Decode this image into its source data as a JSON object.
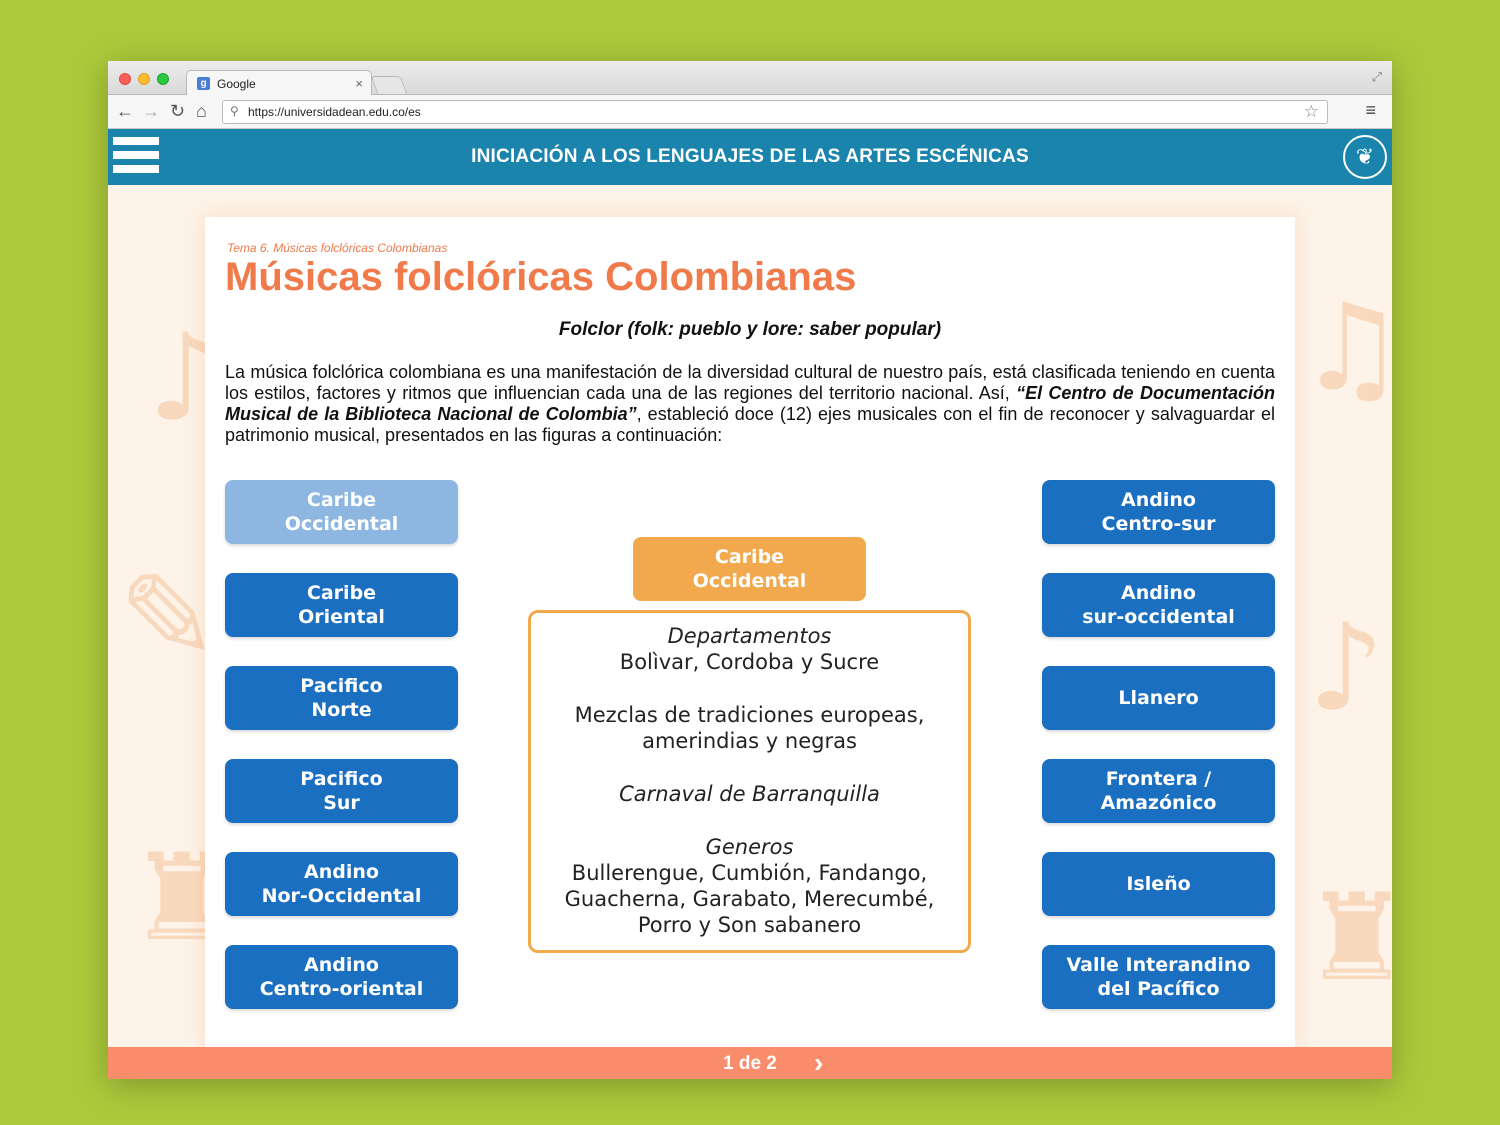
{
  "browser": {
    "tab_title": "Google",
    "tab_favicon": "g",
    "url": "https://universidadean.edu.co/es",
    "icons": [
      "back-icon",
      "forward-icon",
      "reload-icon",
      "home-icon",
      "search-icon",
      "star-icon",
      "menu-icon",
      "close-icon",
      "resize-icon"
    ]
  },
  "header": {
    "title": "INICIACIÓN A LOS LENGUAJES DE LAS ARTES ESCÉNICAS",
    "logo_glyph": "❦"
  },
  "content": {
    "breadcrumb": "Tema 6. Músicas folclóricas Colombianas",
    "title": "Músicas folclóricas Colombianas",
    "subtitle": "Folclor (folk: pueblo y lore: saber popular)",
    "intro_part1": "La música folclórica colombiana es una manifestación de la diversidad cultural de nuestro país, está clasificada teniendo en cuenta los estilos, factores y ritmos que influencian cada una de las regiones del territorio nacional. Así, ",
    "intro_bold": "“El Centro de Documentación Musical de la Biblioteca Nacional de Colombia”",
    "intro_part2": ", estableció doce (12) ejes musicales con el fin de reconocer y salvaguardar el patrimonio musical, presentados en las figuras a continuación:"
  },
  "regions_left": [
    {
      "label": "Caribe\nOccidental",
      "active": true
    },
    {
      "label": "Caribe\nOriental",
      "active": false
    },
    {
      "label": "Pacifico\nNorte",
      "active": false
    },
    {
      "label": "Pacifico\nSur",
      "active": false
    },
    {
      "label": "Andino\nNor-Occidental",
      "active": false
    },
    {
      "label": "Andino\nCentro-oriental",
      "active": false
    }
  ],
  "regions_right": [
    {
      "label": "Andino\nCentro-sur"
    },
    {
      "label": "Andino\nsur-occidental"
    },
    {
      "label": "Llanero"
    },
    {
      "label": "Frontera /\nAmazónico"
    },
    {
      "label": "Isleño"
    },
    {
      "label": "Valle Interandino\ndel Pacífico"
    }
  ],
  "detail": {
    "selected": "Caribe\nOccidental",
    "departamentos_label": "Departamentos",
    "departamentos": "Bolìvar, Cordoba y Sucre",
    "mezclas_line1": "Mezclas de tradiciones europeas,",
    "mezclas_line2": "amerindias y negras",
    "carnaval": "Carnaval de Barranquilla",
    "generos_label": "Generos",
    "generos_line1": "Bullerengue, Cumbión, Fandango,",
    "generos_line2": "Guacherna, Garabato, Merecumbé,",
    "generos_line3": "Porro y Son sabanero"
  },
  "footer": {
    "pager": "1 de 2",
    "next_glyph": "›"
  },
  "colors": {
    "header": "#1b84ad",
    "button": "#1a6fc1",
    "button_active": "#8db7e0",
    "accent_orange": "#f07a4a",
    "selected_orange": "#f2a94e",
    "footer": "#f98c6b",
    "page_bg": "#acc93b"
  }
}
